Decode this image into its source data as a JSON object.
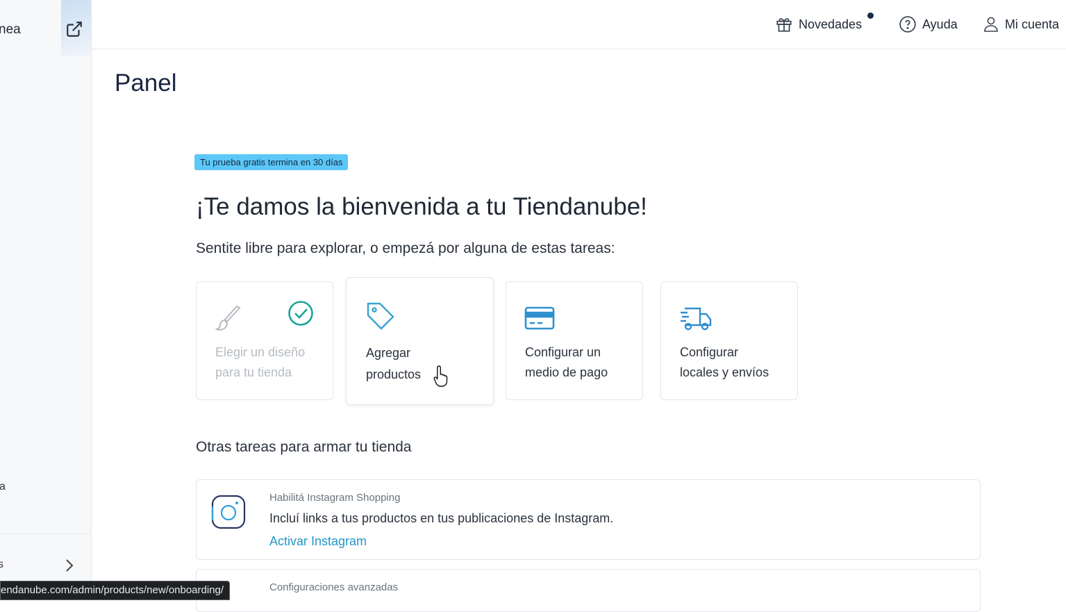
{
  "sidebar": {
    "top_text": "nea",
    "mid_text": "a",
    "bottom_text": "s"
  },
  "topbar": {
    "novedades": "Novedades",
    "ayuda": "Ayuda",
    "cuenta": "Mi cuenta"
  },
  "page": {
    "title": "Panel",
    "trial_badge": "Tu prueba gratis termina en 30 días",
    "welcome": "¡Te damos la bienvenida a tu Tiendanube!",
    "subtitle": "Sentite libre para explorar, o empezá por alguna de estas tareas:"
  },
  "cards": [
    {
      "line1": "Elegir un diseño",
      "line2": "para tu tienda",
      "icon": "paintbrush-icon",
      "completed": true
    },
    {
      "line1": "Agregar",
      "line2": "productos",
      "icon": "tag-icon",
      "completed": false
    },
    {
      "line1": "Configurar un",
      "line2": "medio de pago",
      "icon": "credit-card-icon",
      "completed": false
    },
    {
      "line1": "Configurar",
      "line2": "locales y envíos",
      "icon": "truck-icon",
      "completed": false
    }
  ],
  "others": {
    "heading": "Otras tareas para armar tu tienda",
    "tasks": [
      {
        "title": "Habilitá Instagram Shopping",
        "desc": "Incluí links a tus productos en tus publicaciones de Instagram.",
        "link": "Activar Instagram",
        "icon": "instagram-icon"
      },
      {
        "title": "Configuraciones avanzadas"
      }
    ]
  },
  "statusbar": {
    "url": "endanube.com/admin/products/new/onboarding/"
  },
  "colors": {
    "accent": "#2196c9",
    "badge": "#5dc7f7",
    "success": "#1aa39a"
  }
}
